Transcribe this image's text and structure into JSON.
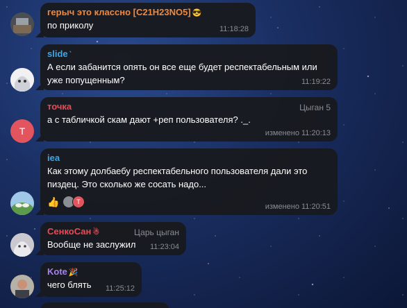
{
  "colors": {
    "name_orange": "#f0893d",
    "name_blue": "#3fa7e6",
    "name_red": "#e84b55",
    "name_purple": "#a881f2",
    "bubble_bg": "#181a1e",
    "meta_gray": "#8a8d93",
    "avatar_red": "#e2555e"
  },
  "messages": [
    {
      "author": "герыч это классно [C21H23NO5]",
      "author_emoji": "😎",
      "text_lines": [
        "по приколу"
      ],
      "time": "11:18:28",
      "avatar_icon": "photo-avatar-icon"
    },
    {
      "author": "slide",
      "author_emoji": "`",
      "text_lines": [
        "А если забанится опять он все еще будет респектабельным или",
        "уже попущенным?"
      ],
      "time": "11:19:22",
      "avatar_icon": "anime-avatar-icon"
    },
    {
      "author": "точка",
      "tag": "Цыган 5",
      "text_lines": [
        "а с табличкой скам дают +реп пользователя? ._."
      ],
      "time": "изменено 11:20:13",
      "avatar_letter": "Т"
    },
    {
      "author": "iea",
      "text_lines": [
        "Как этому долбаебу респектабельного пользователя дали это",
        "пиздец. Это сколько же сосать надо..."
      ],
      "time": "изменено 11:20:51",
      "reaction_emoji": "👍",
      "reaction_avatar_letter": "T",
      "avatar_icon": "pepe-avatar-icon"
    },
    {
      "author": "СенкоСан",
      "author_emoji": "☃",
      "tag": "Царь цыган",
      "text_lines": [
        "Вообще не заслужил"
      ],
      "time": "11:23:04",
      "avatar_icon": "anime-avatar-icon"
    },
    {
      "author": "Kote",
      "author_emoji": "🎉",
      "text_lines": [
        "чего блять"
      ],
      "time": "11:25:12",
      "avatar_icon": "photo-avatar-icon"
    }
  ]
}
